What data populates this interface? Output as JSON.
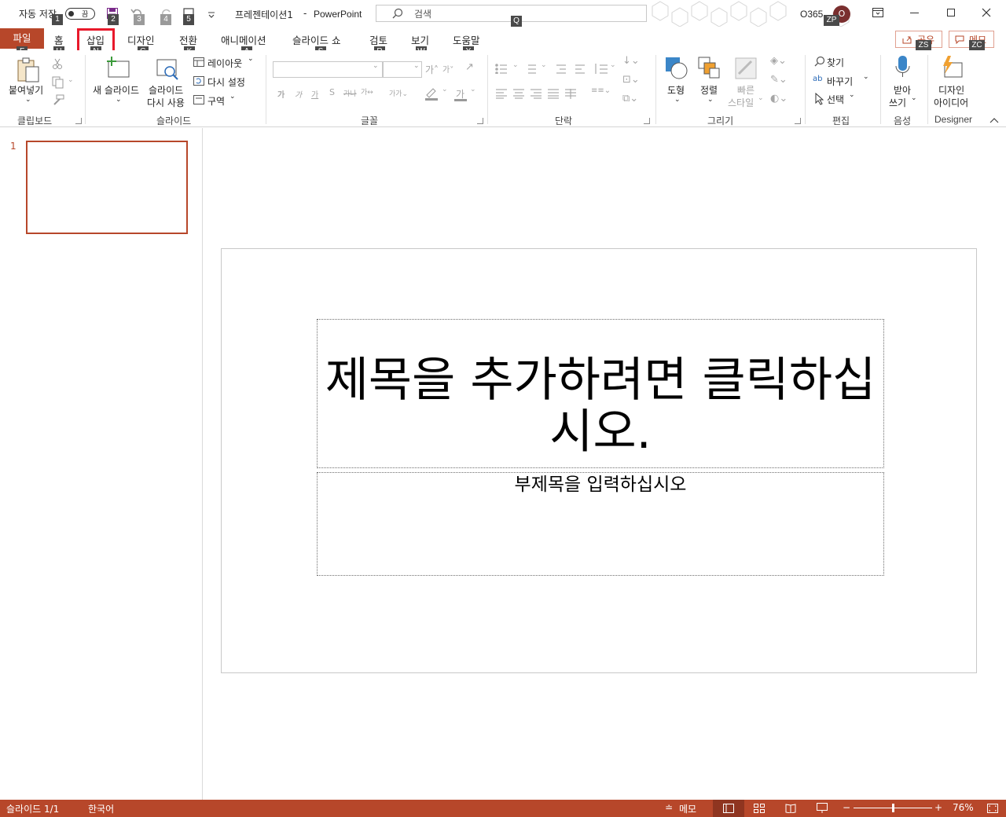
{
  "titlebar": {
    "autosave_label": "자동 저장",
    "autosave_state": "끔",
    "doc_title": "프레젠테이션1",
    "separator": "-",
    "app_name": "PowerPoint",
    "search_placeholder": "검색",
    "account": "O365",
    "avatar_initial": "O",
    "keytips": {
      "autosave": "1",
      "save": "2",
      "undo": "3",
      "redo": "4",
      "present": "5",
      "search": "Q",
      "account": "ZP"
    }
  },
  "tabs": [
    {
      "label": "파일",
      "keytip": "F"
    },
    {
      "label": "홈",
      "keytip": "H"
    },
    {
      "label": "삽입",
      "keytip": "N"
    },
    {
      "label": "디자인",
      "keytip": "G"
    },
    {
      "label": "전환",
      "keytip": "K"
    },
    {
      "label": "애니메이션",
      "keytip": "A"
    },
    {
      "label": "슬라이드 쇼",
      "keytip": "S"
    },
    {
      "label": "검토",
      "keytip": "R"
    },
    {
      "label": "보기",
      "keytip": "W"
    },
    {
      "label": "도움말",
      "keytip": "Y"
    }
  ],
  "share": {
    "label": "공유",
    "keytip": "ZS"
  },
  "comments": {
    "label": "메모",
    "keytip": "ZC"
  },
  "ribbon": {
    "clipboard": {
      "label": "클립보드",
      "paste": "붙여넣기"
    },
    "slides": {
      "label": "슬라이드",
      "new_slide": "새 슬라이드",
      "reuse_line1": "슬라이드",
      "reuse_line2": "다시 사용",
      "layout": "레이아웃",
      "reset": "다시 설정",
      "section": "구역"
    },
    "font": {
      "label": "글꼴",
      "font_name": "",
      "font_size": ""
    },
    "paragraph": {
      "label": "단락"
    },
    "drawing": {
      "label": "그리기",
      "shapes": "도형",
      "arrange": "정렬",
      "quick_line1": "빠른",
      "quick_line2": "스타일"
    },
    "editing": {
      "label": "편집",
      "find": "찾기",
      "replace": "바꾸기",
      "select": "선택"
    },
    "voice": {
      "label": "음성",
      "dictate_line1": "받아",
      "dictate_line2": "쓰기"
    },
    "designer": {
      "label": "Designer",
      "ideas_line1": "디자인",
      "ideas_line2": "아이디어"
    }
  },
  "thumbnails": {
    "slide_number": "1"
  },
  "slide": {
    "title_placeholder": "제목을 추가하려면 클릭하십시오.",
    "subtitle_placeholder": "부제목을 입력하십시오"
  },
  "statusbar": {
    "slide_info": "슬라이드 1/1",
    "language": "한국어",
    "notes": "메모",
    "zoom_minus": "−",
    "zoom_plus": "+",
    "zoom_value": "76%",
    "zoom_fraction": 0.5
  },
  "colors": {
    "accent": "#b7472a",
    "highlight": "#e8192b",
    "thumb_border": "#b7472a"
  }
}
